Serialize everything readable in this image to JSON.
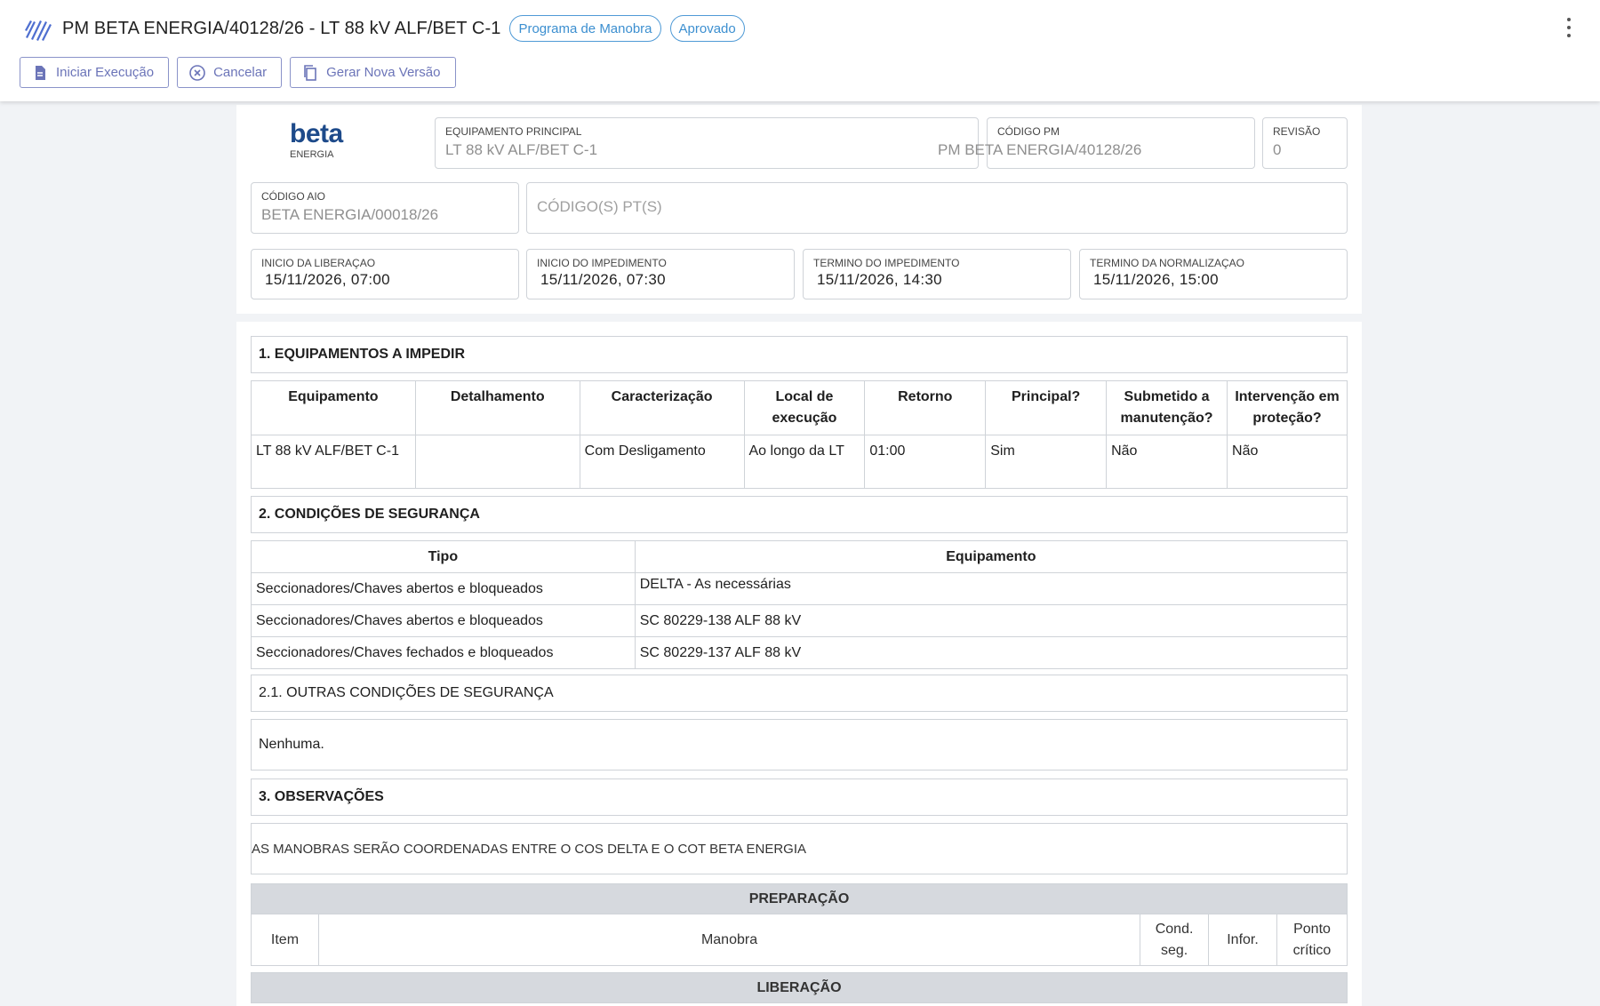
{
  "header": {
    "title": "PM BETA ENERGIA/40128/26 - LT 88 kV ALF/BET C-1",
    "chips": [
      "Programa de Manobra",
      "Aprovado"
    ],
    "actions": [
      "Iniciar Execução",
      "Cancelar",
      "Gerar Nova Versão"
    ]
  },
  "brand": {
    "name": "beta",
    "sub": "ENERGIA"
  },
  "fields": {
    "equipamento_principal": {
      "label": "EQUIPAMENTO PRINCIPAL",
      "value": "LT 88 kV ALF/BET C-1"
    },
    "codigo_pm": {
      "label": "CÓDIGO PM",
      "value": "PM BETA ENERGIA/40128/26"
    },
    "revisao": {
      "label": "REVISÃO",
      "value": "0"
    },
    "codigo_aio": {
      "label": "CÓDIGO AIO",
      "value": "BETA ENERGIA/00018/26"
    },
    "codigos_pt": {
      "placeholder": "CÓDIGO(S) PT(S)"
    },
    "inicio_liberacao": {
      "label": "INICIO DA LIBERAÇAO",
      "value": "15/11/2026, 07:00"
    },
    "inicio_impedimento": {
      "label": "INICIO DO IMPEDIMENTO",
      "value": "15/11/2026, 07:30"
    },
    "termino_impedimento": {
      "label": "TERMINO DO IMPEDIMENTO",
      "value": "15/11/2026, 14:30"
    },
    "termino_normalizacao": {
      "label": "TERMINO DA NORMALIZAÇAO",
      "value": "15/11/2026, 15:00"
    }
  },
  "section1": {
    "title": "1. EQUIPAMENTOS A IMPEDIR",
    "headers": [
      "Equipamento",
      "Detalhamento",
      "Caracterização",
      "Local de execução",
      "Retorno",
      "Principal?",
      "Submetido a manutenção?",
      "Intervenção em proteção?"
    ],
    "rows": [
      [
        "LT 88 kV  ALF/BET   C-1",
        "",
        "Com Desligamento",
        "Ao longo da LT",
        "01:00",
        "Sim",
        "Não",
        "Não"
      ]
    ]
  },
  "section2": {
    "title": "2. CONDIÇÕES DE SEGURANÇA",
    "headers": [
      "Tipo",
      "Equipamento"
    ],
    "rows": [
      [
        "Seccionadores/Chaves abertos e bloqueados",
        "DELTA - As necessárias"
      ],
      [
        "Seccionadores/Chaves abertos e bloqueados",
        "SC  80229-138   ALF   88 kV"
      ],
      [
        "Seccionadores/Chaves fechados e bloqueados",
        "SC  80229-137   ALF   88 kV"
      ]
    ]
  },
  "section21": {
    "title": "2.1. OUTRAS CONDIÇÕES DE SEGURANÇA",
    "text": "Nenhuma."
  },
  "section3": {
    "title": "3. OBSERVAÇÕES",
    "text": "AS MANOBRAS SERÃO COORDENADAS ENTRE O COS DELTA E O COT BETA ENERGIA"
  },
  "manobras": {
    "preparacao": "PREPARAÇÃO",
    "headers": [
      "Item",
      "Manobra",
      "Cond. seg.",
      "Infor.",
      "Ponto crítico"
    ],
    "liberacao": "LIBERAÇÃO"
  }
}
